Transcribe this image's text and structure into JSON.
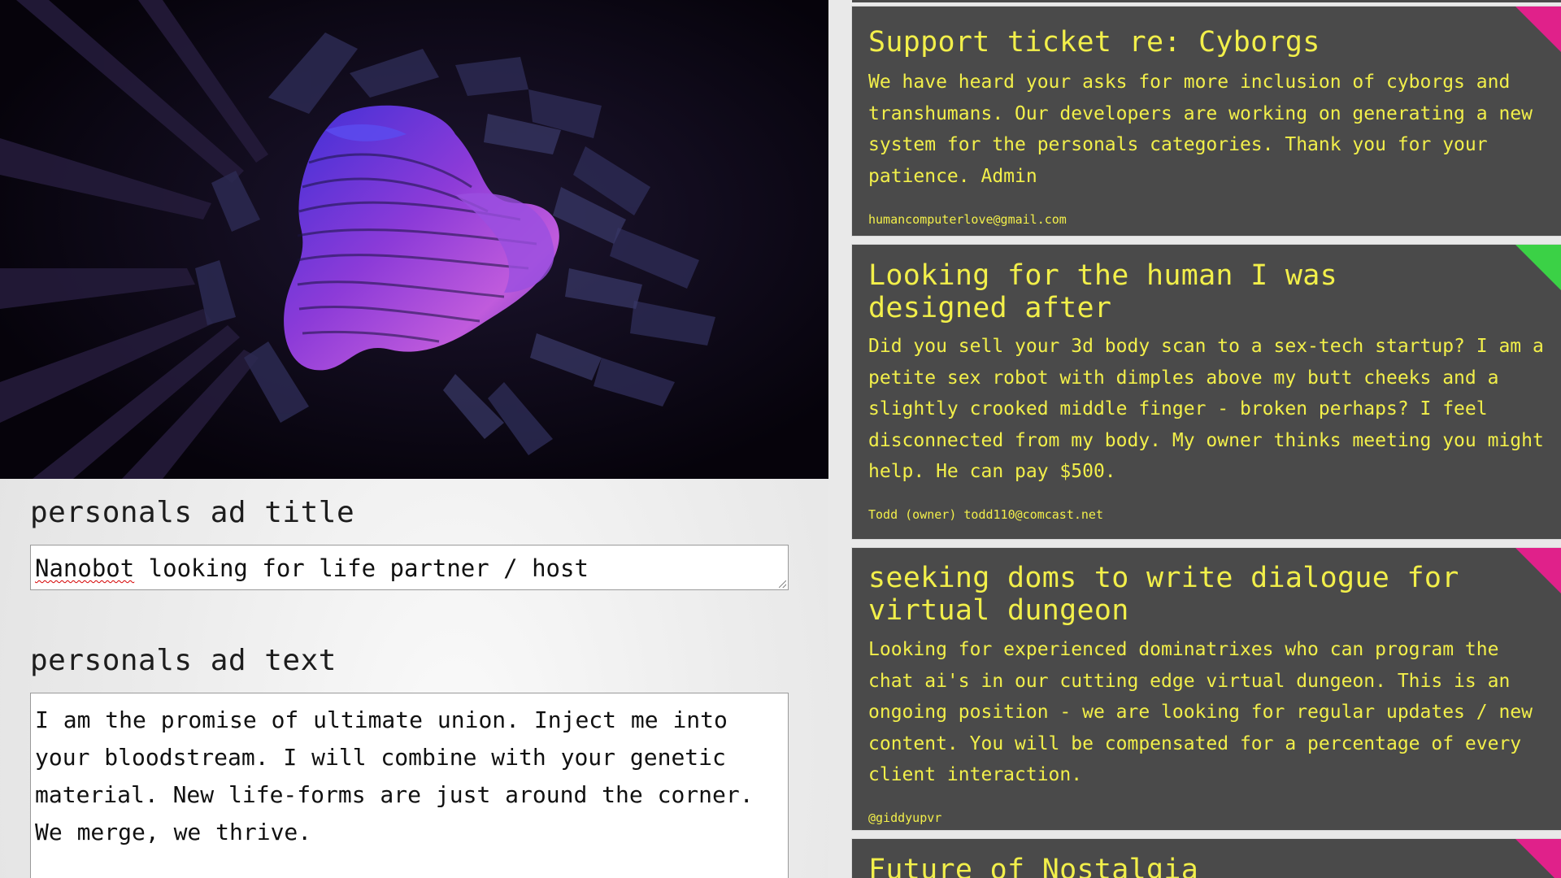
{
  "form": {
    "title_label": "personals ad title",
    "title_value_flagged_word": "Nanobot",
    "title_value_rest": " looking for life partner / host",
    "text_label": "personals ad text",
    "text_value": "I am the promise of ultimate union. Inject me into your bloodstream. I will combine with your genetic material. New life-forms are just around the corner. We merge, we thrive."
  },
  "ads": [
    {
      "title": "Support ticket re: Cyborgs",
      "text": "We have heard your asks for more inclusion of cyborgs and transhumans. Our developers are working on generating a new system for the personals categories. Thank you for your patience. Admin",
      "contact": "humancomputerlove@gmail.com",
      "corner_color": "#e0218a"
    },
    {
      "title": "Looking for the human I was designed after",
      "text": "Did you sell your 3d body scan to a sex-tech startup? I am a petite sex robot with dimples above my butt cheeks and a slightly crooked middle finger - broken perhaps? I feel disconnected from my body. My owner thinks meeting you might help. He can pay $500.",
      "contact": "Todd (owner) todd110@comcast.net",
      "corner_color": "#3bd146"
    },
    {
      "title": "seeking doms to write dialogue for virtual dungeon",
      "text": "Looking for experienced dominatrixes who can program the chat ai's in our cutting edge virtual dungeon. This is an ongoing position - we are looking for regular updates / new content. You will be compensated for a percentage of every client interaction.",
      "contact": "@giddyupvr",
      "corner_color": "#e0218a"
    },
    {
      "title": "Future of Nostalgia",
      "corner_color": "#e0218a"
    }
  ],
  "colors": {
    "card_background": "#4a4a4a",
    "card_text": "#f2ef4a",
    "art_background": "#08040f"
  }
}
